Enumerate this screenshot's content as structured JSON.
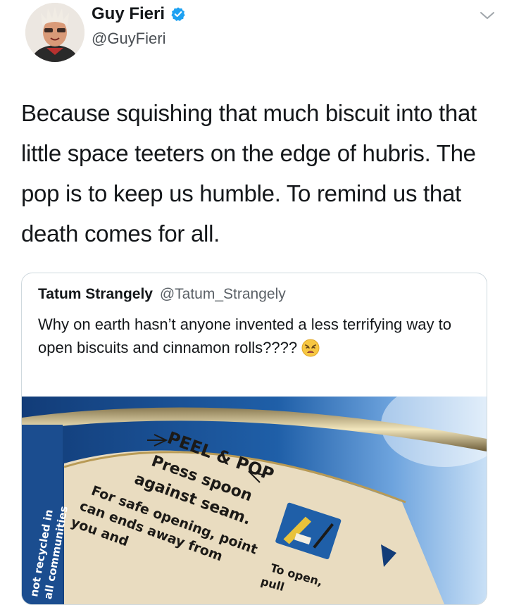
{
  "tweet": {
    "author": {
      "display_name": "Guy Fieri",
      "handle": "@GuyFieri",
      "verified": true,
      "avatar_icon": "guy-fieri-avatar"
    },
    "menu_icon": "chevron-down-icon",
    "text": "Because squishing that much biscuit into that little space teeters on the edge of hubris. The pop is to keep us humble. To remind us that death comes for all."
  },
  "quoted_tweet": {
    "display_name": "Tatum Strangely",
    "handle": "@Tatum_Strangely",
    "text": "Why on earth hasn’t anyone invented a less terrifying way to open biscuits and cinnamon rolls????",
    "emoji": "weary-face-emoji",
    "image": {
      "side_label_1": "not recycled in",
      "side_label_2": "all communities",
      "headline": "PEEL & POP",
      "instruction_1": "Press spoon",
      "instruction_2": "against seam.",
      "safety_1": "For safe opening, point",
      "safety_2": "can ends away from",
      "safety_3": "you and",
      "open_1": "To open,",
      "open_2": "pull"
    }
  },
  "colors": {
    "verified_blue": "#1da1f2",
    "can_blue": "#1f5fa8",
    "label_cream": "#e9dcc0",
    "text_primary": "#14171a",
    "text_secondary": "#5b6167"
  }
}
